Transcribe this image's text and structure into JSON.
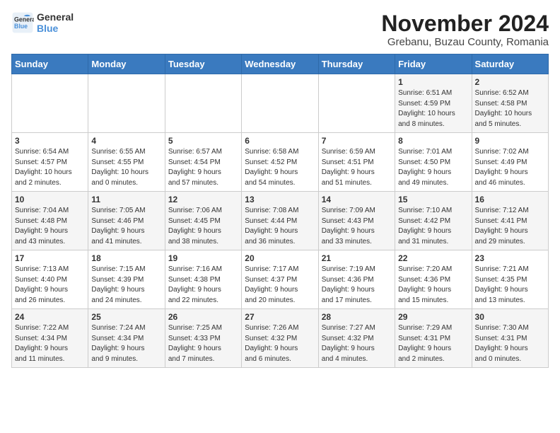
{
  "logo": {
    "line1": "General",
    "line2": "Blue"
  },
  "title": {
    "month_year": "November 2024",
    "location": "Grebanu, Buzau County, Romania"
  },
  "weekdays": [
    "Sunday",
    "Monday",
    "Tuesday",
    "Wednesday",
    "Thursday",
    "Friday",
    "Saturday"
  ],
  "weeks": [
    [
      {
        "day": "",
        "detail": ""
      },
      {
        "day": "",
        "detail": ""
      },
      {
        "day": "",
        "detail": ""
      },
      {
        "day": "",
        "detail": ""
      },
      {
        "day": "",
        "detail": ""
      },
      {
        "day": "1",
        "detail": "Sunrise: 6:51 AM\nSunset: 4:59 PM\nDaylight: 10 hours\nand 8 minutes."
      },
      {
        "day": "2",
        "detail": "Sunrise: 6:52 AM\nSunset: 4:58 PM\nDaylight: 10 hours\nand 5 minutes."
      }
    ],
    [
      {
        "day": "3",
        "detail": "Sunrise: 6:54 AM\nSunset: 4:57 PM\nDaylight: 10 hours\nand 2 minutes."
      },
      {
        "day": "4",
        "detail": "Sunrise: 6:55 AM\nSunset: 4:55 PM\nDaylight: 10 hours\nand 0 minutes."
      },
      {
        "day": "5",
        "detail": "Sunrise: 6:57 AM\nSunset: 4:54 PM\nDaylight: 9 hours\nand 57 minutes."
      },
      {
        "day": "6",
        "detail": "Sunrise: 6:58 AM\nSunset: 4:52 PM\nDaylight: 9 hours\nand 54 minutes."
      },
      {
        "day": "7",
        "detail": "Sunrise: 6:59 AM\nSunset: 4:51 PM\nDaylight: 9 hours\nand 51 minutes."
      },
      {
        "day": "8",
        "detail": "Sunrise: 7:01 AM\nSunset: 4:50 PM\nDaylight: 9 hours\nand 49 minutes."
      },
      {
        "day": "9",
        "detail": "Sunrise: 7:02 AM\nSunset: 4:49 PM\nDaylight: 9 hours\nand 46 minutes."
      }
    ],
    [
      {
        "day": "10",
        "detail": "Sunrise: 7:04 AM\nSunset: 4:48 PM\nDaylight: 9 hours\nand 43 minutes."
      },
      {
        "day": "11",
        "detail": "Sunrise: 7:05 AM\nSunset: 4:46 PM\nDaylight: 9 hours\nand 41 minutes."
      },
      {
        "day": "12",
        "detail": "Sunrise: 7:06 AM\nSunset: 4:45 PM\nDaylight: 9 hours\nand 38 minutes."
      },
      {
        "day": "13",
        "detail": "Sunrise: 7:08 AM\nSunset: 4:44 PM\nDaylight: 9 hours\nand 36 minutes."
      },
      {
        "day": "14",
        "detail": "Sunrise: 7:09 AM\nSunset: 4:43 PM\nDaylight: 9 hours\nand 33 minutes."
      },
      {
        "day": "15",
        "detail": "Sunrise: 7:10 AM\nSunset: 4:42 PM\nDaylight: 9 hours\nand 31 minutes."
      },
      {
        "day": "16",
        "detail": "Sunrise: 7:12 AM\nSunset: 4:41 PM\nDaylight: 9 hours\nand 29 minutes."
      }
    ],
    [
      {
        "day": "17",
        "detail": "Sunrise: 7:13 AM\nSunset: 4:40 PM\nDaylight: 9 hours\nand 26 minutes."
      },
      {
        "day": "18",
        "detail": "Sunrise: 7:15 AM\nSunset: 4:39 PM\nDaylight: 9 hours\nand 24 minutes."
      },
      {
        "day": "19",
        "detail": "Sunrise: 7:16 AM\nSunset: 4:38 PM\nDaylight: 9 hours\nand 22 minutes."
      },
      {
        "day": "20",
        "detail": "Sunrise: 7:17 AM\nSunset: 4:37 PM\nDaylight: 9 hours\nand 20 minutes."
      },
      {
        "day": "21",
        "detail": "Sunrise: 7:19 AM\nSunset: 4:36 PM\nDaylight: 9 hours\nand 17 minutes."
      },
      {
        "day": "22",
        "detail": "Sunrise: 7:20 AM\nSunset: 4:36 PM\nDaylight: 9 hours\nand 15 minutes."
      },
      {
        "day": "23",
        "detail": "Sunrise: 7:21 AM\nSunset: 4:35 PM\nDaylight: 9 hours\nand 13 minutes."
      }
    ],
    [
      {
        "day": "24",
        "detail": "Sunrise: 7:22 AM\nSunset: 4:34 PM\nDaylight: 9 hours\nand 11 minutes."
      },
      {
        "day": "25",
        "detail": "Sunrise: 7:24 AM\nSunset: 4:34 PM\nDaylight: 9 hours\nand 9 minutes."
      },
      {
        "day": "26",
        "detail": "Sunrise: 7:25 AM\nSunset: 4:33 PM\nDaylight: 9 hours\nand 7 minutes."
      },
      {
        "day": "27",
        "detail": "Sunrise: 7:26 AM\nSunset: 4:32 PM\nDaylight: 9 hours\nand 6 minutes."
      },
      {
        "day": "28",
        "detail": "Sunrise: 7:27 AM\nSunset: 4:32 PM\nDaylight: 9 hours\nand 4 minutes."
      },
      {
        "day": "29",
        "detail": "Sunrise: 7:29 AM\nSunset: 4:31 PM\nDaylight: 9 hours\nand 2 minutes."
      },
      {
        "day": "30",
        "detail": "Sunrise: 7:30 AM\nSunset: 4:31 PM\nDaylight: 9 hours\nand 0 minutes."
      }
    ]
  ]
}
